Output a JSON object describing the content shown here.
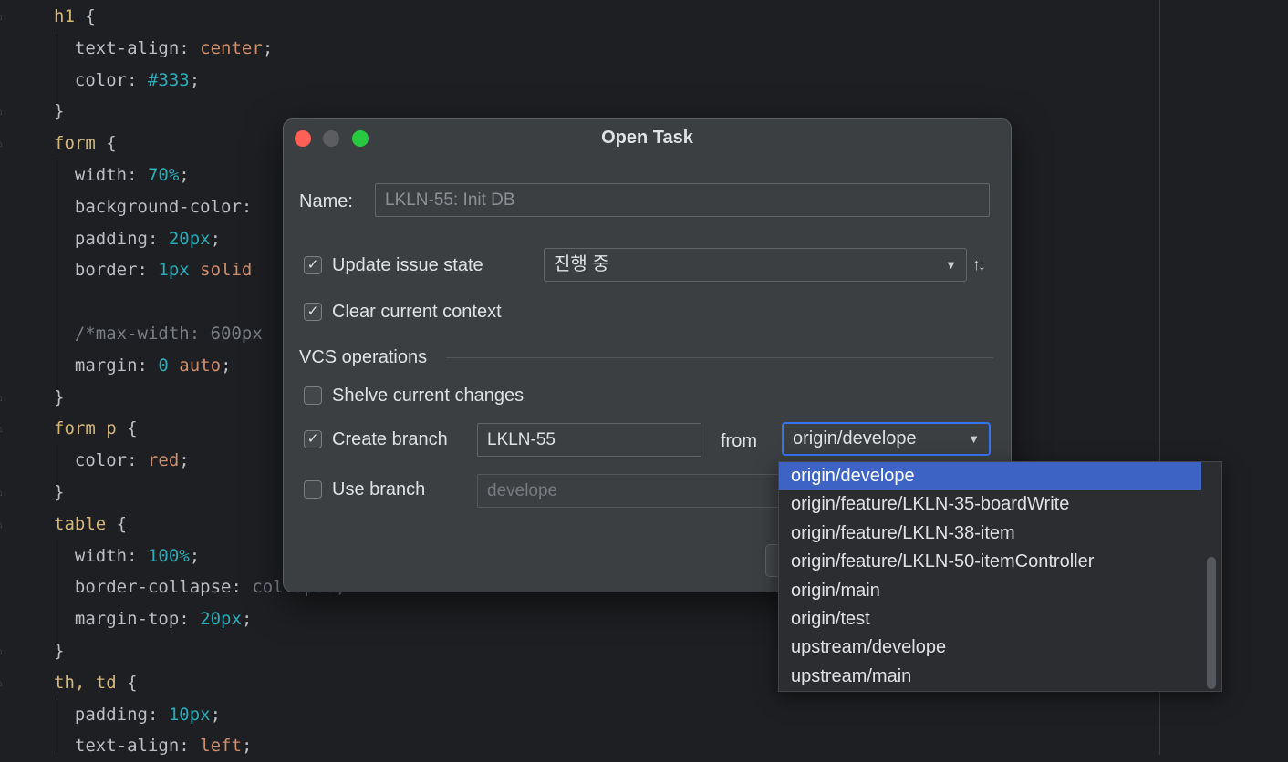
{
  "editor": {
    "lines": [
      {
        "parts": [
          [
            "sel",
            "h1"
          ],
          [
            "punc",
            " {"
          ]
        ]
      },
      {
        "parts": [
          [
            "prop",
            "  text-align"
          ],
          [
            "punc",
            ": "
          ],
          [
            "val",
            "center"
          ],
          [
            "punc",
            ";"
          ]
        ]
      },
      {
        "parts": [
          [
            "prop",
            "  color"
          ],
          [
            "punc",
            ": "
          ],
          [
            "numb",
            "#333"
          ],
          [
            "punc",
            ";"
          ]
        ]
      },
      {
        "parts": [
          [
            "punc",
            "}"
          ]
        ]
      },
      {
        "parts": [
          [
            "sel",
            "form"
          ],
          [
            "punc",
            " {"
          ]
        ]
      },
      {
        "parts": [
          [
            "prop",
            "  width"
          ],
          [
            "punc",
            ": "
          ],
          [
            "numb",
            "70%"
          ],
          [
            "punc",
            ";"
          ]
        ]
      },
      {
        "parts": [
          [
            "prop",
            "  background-color"
          ],
          [
            "punc",
            ":"
          ]
        ]
      },
      {
        "parts": [
          [
            "prop",
            "  padding"
          ],
          [
            "punc",
            ": "
          ],
          [
            "numb",
            "20px"
          ],
          [
            "punc",
            ";"
          ]
        ]
      },
      {
        "parts": [
          [
            "prop",
            "  border"
          ],
          [
            "punc",
            ": "
          ],
          [
            "numb",
            "1px"
          ],
          [
            "val",
            " solid"
          ]
        ]
      },
      {
        "parts": [
          [
            "punc",
            ""
          ]
        ]
      },
      {
        "parts": [
          [
            "cmt",
            "  /*max-width: 600px"
          ]
        ]
      },
      {
        "parts": [
          [
            "prop",
            "  margin"
          ],
          [
            "punc",
            ": "
          ],
          [
            "numb",
            "0"
          ],
          [
            "val",
            " auto"
          ],
          [
            "punc",
            ";"
          ]
        ]
      },
      {
        "parts": [
          [
            "punc",
            "}"
          ]
        ]
      },
      {
        "parts": [
          [
            "sel",
            "form p"
          ],
          [
            "punc",
            " {"
          ]
        ]
      },
      {
        "parts": [
          [
            "prop",
            "  color"
          ],
          [
            "punc",
            ": "
          ],
          [
            "val",
            "red"
          ],
          [
            "punc",
            ";"
          ]
        ]
      },
      {
        "parts": [
          [
            "punc",
            "}"
          ]
        ]
      },
      {
        "parts": [
          [
            "sel",
            "table"
          ],
          [
            "punc",
            " {"
          ]
        ]
      },
      {
        "parts": [
          [
            "prop",
            "  width"
          ],
          [
            "punc",
            ": "
          ],
          [
            "numb",
            "100%"
          ],
          [
            "punc",
            ";"
          ]
        ]
      },
      {
        "parts": [
          [
            "prop",
            "  border-collapse"
          ],
          [
            "punc",
            ": "
          ],
          [
            "cmt",
            "collapse;"
          ]
        ]
      },
      {
        "parts": [
          [
            "prop",
            "  margin-top"
          ],
          [
            "punc",
            ": "
          ],
          [
            "numb",
            "20px"
          ],
          [
            "punc",
            ";"
          ]
        ]
      },
      {
        "parts": [
          [
            "punc",
            "}"
          ]
        ]
      },
      {
        "parts": [
          [
            "sel",
            "th, td"
          ],
          [
            "punc",
            " {"
          ]
        ]
      },
      {
        "parts": [
          [
            "prop",
            "  padding"
          ],
          [
            "punc",
            ": "
          ],
          [
            "numb",
            "10px"
          ],
          [
            "punc",
            ";"
          ]
        ]
      },
      {
        "parts": [
          [
            "prop",
            "  text-align"
          ],
          [
            "punc",
            ": "
          ],
          [
            "val",
            "left"
          ],
          [
            "punc",
            ";"
          ]
        ]
      }
    ]
  },
  "dialog": {
    "title": "Open Task",
    "name_label": "Name:",
    "name_placeholder": "LKLN-55: Init DB",
    "update_issue_label": "Update issue state",
    "update_issue_checked": true,
    "issue_state_value": "진행 중",
    "clear_context_label": "Clear current context",
    "clear_context_checked": true,
    "vcs_section_label": "VCS operations",
    "shelve_label": "Shelve current changes",
    "shelve_checked": false,
    "create_branch_label": "Create branch",
    "create_branch_checked": true,
    "create_branch_value": "LKLN-55",
    "from_label": "from",
    "from_value": "origin/develope",
    "use_branch_label": "Use branch",
    "use_branch_checked": false,
    "use_branch_value": "develope"
  },
  "branch_popup": {
    "items": [
      "origin/develope",
      "origin/feature/LKLN-35-boardWrite",
      "origin/feature/LKLN-38-item",
      "origin/feature/LKLN-50-itemController",
      "origin/main",
      "origin/test",
      "upstream/develope",
      "upstream/main"
    ],
    "selected_index": 0
  },
  "colors": {
    "accent": "#3574f0",
    "selection": "#3d64c5",
    "dialog_bg": "#3c3f41",
    "editor_bg": "#1e1f22"
  }
}
